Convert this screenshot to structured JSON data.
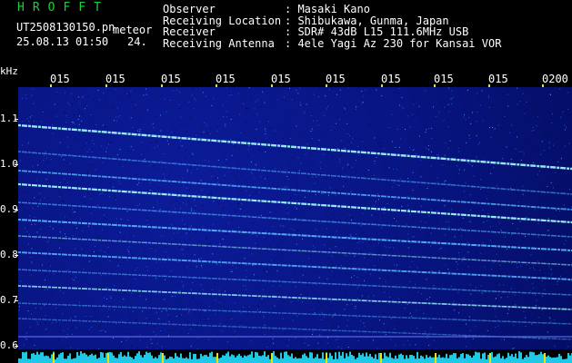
{
  "header": {
    "logo": "HROFFT",
    "filename": "UT2508130150.pn",
    "tag": "meteor",
    "datetime": "25.08.13 01:50",
    "value": "24.",
    "info_rows": [
      {
        "key": "Observer",
        "value": ": Masaki Kano"
      },
      {
        "key": "Receiving Location",
        "value": ": Shibukawa, Gunma, Japan"
      },
      {
        "key": "Receiver",
        "value": ": SDR# 43dB L15 111.6MHz USB"
      },
      {
        "key": "Receiving Antenna",
        "value": ": 4ele Yagi Az 230 for Kansai VOR"
      }
    ]
  },
  "time_axis": {
    "labels": [
      "015",
      "015",
      "015",
      "015",
      "015",
      "015",
      "015",
      "015",
      "015",
      "0200"
    ]
  },
  "freq_axis": {
    "unit": "kHz",
    "labels": [
      "1.1",
      "1.0",
      "0.9",
      "0.8",
      "0.7",
      "0.6"
    ]
  },
  "colors": {
    "background": "#000000",
    "plot_bg": "#071480",
    "trace": "#5ab8ff",
    "trace_bright": "#9ff6ff",
    "logo": "#19d23a",
    "tick_yellow": "#e6e600",
    "bottom_bar": "#1ec8e6"
  }
}
